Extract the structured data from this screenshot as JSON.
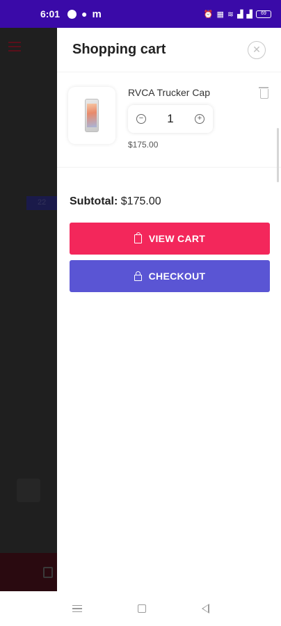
{
  "status_bar": {
    "time": "6:01",
    "icons": [
      "circle-icon",
      "chat-icon",
      "m-letter-icon",
      "alarm-icon",
      "volte-icon",
      "wifi-icon",
      "signal-icon",
      "signal-icon",
      "battery-icon"
    ],
    "battery_level": "69"
  },
  "background_app": {
    "badge_text": "22"
  },
  "cart": {
    "title": "Shopping cart",
    "items": [
      {
        "name": "RVCA Trucker Cap",
        "quantity": "1",
        "price": "$175.00",
        "image": "phone-product-image"
      }
    ],
    "subtotal_label": "Subtotal:",
    "subtotal_value": "$175.00",
    "view_cart_label": "VIEW CART",
    "checkout_label": "CHECKOUT"
  },
  "colors": {
    "status_bar": "#3a0aa8",
    "view_cart": "#f3275b",
    "checkout": "#5a55d4"
  }
}
